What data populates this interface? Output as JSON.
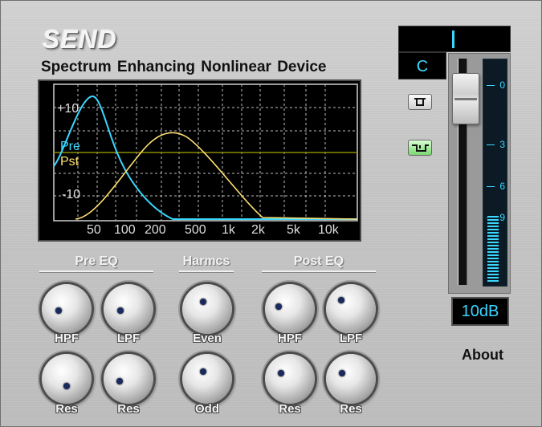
{
  "header": {
    "title": "SEND",
    "subtitle": "Spectrum Enhancing Nonlinear Device"
  },
  "graph": {
    "y_labels": [
      "+10",
      "-10"
    ],
    "legend": [
      {
        "label": "Pre",
        "color": "#3ad7ff"
      },
      {
        "label": "Pst",
        "color": "#ffe070"
      }
    ],
    "x_labels": [
      "50",
      "100",
      "200",
      "500",
      "1k",
      "2k",
      "5k",
      "10k"
    ],
    "reference_line_color": "#8a8a00"
  },
  "sections": {
    "pre_eq": "Pre EQ",
    "harmcs": "Harmcs",
    "post_eq": "Post EQ"
  },
  "knobs": {
    "pre_hpf": "HPF",
    "pre_lpf": "LPF",
    "even": "Even",
    "post_hpf": "HPF",
    "post_lpf": "LPF",
    "pre_res1": "Res",
    "pre_res2": "Res",
    "odd": "Odd",
    "post_res1": "Res",
    "post_res2": "Res"
  },
  "meter": {
    "mode": "C",
    "scale": [
      "0",
      "3",
      "6",
      "9"
    ],
    "value_display": "10dB",
    "level": 0.3
  },
  "about": "About",
  "colors": {
    "accent_cyan": "#3ad7ff",
    "accent_yellow": "#ffe070",
    "panel": "#c6c6c6"
  }
}
